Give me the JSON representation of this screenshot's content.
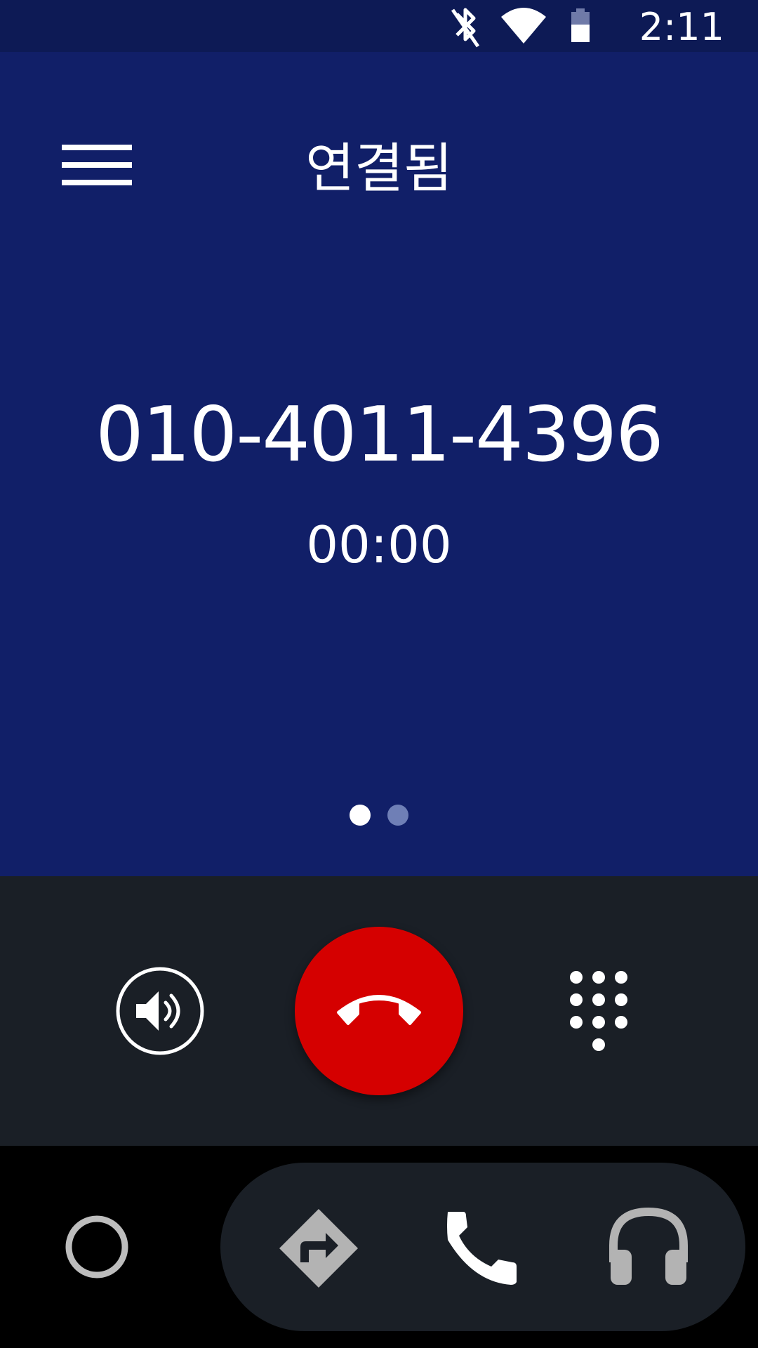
{
  "status_bar": {
    "time": "2:11",
    "icons": [
      "bluetooth-off-icon",
      "wifi-icon",
      "battery-icon"
    ]
  },
  "call": {
    "status": "연결됨",
    "number": "010-4011-4396",
    "duration": "00:00",
    "pages": {
      "count": 2,
      "active": 1
    }
  },
  "controls": {
    "icons": [
      "speaker-icon",
      "end-call-icon",
      "dialpad-icon"
    ],
    "end_call_color": "#d50000"
  },
  "nav": {
    "icons": [
      "home-icon",
      "navigation-icon",
      "phone-icon",
      "music-headphones-icon"
    ]
  },
  "colors": {
    "status_bar": "#0d1a55",
    "call_background": "#111f68",
    "controls_background": "#1a1f26"
  }
}
